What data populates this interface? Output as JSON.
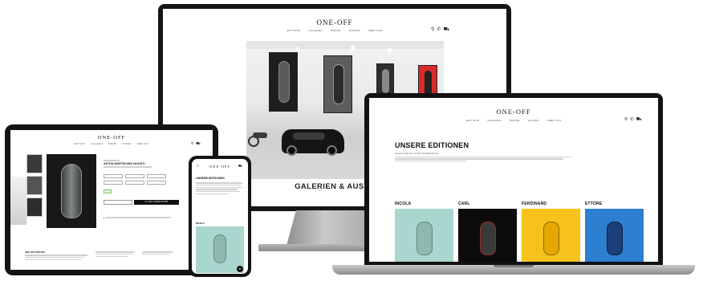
{
  "brand": {
    "logo": "ONE-OFF",
    "nav": [
      "EDITIONS",
      "GALERIEN",
      "PREISE",
      "WISSEN",
      "ÜBER UNS"
    ],
    "icons": [
      "search-icon",
      "phone-icon",
      "cart-icon"
    ]
  },
  "monitor": {
    "caption": "GALERIEN & AUSSTELLU"
  },
  "laptop": {
    "heading": "UNSERE EDITIONEN",
    "intro": "Entdeckt ONE-OFF und ihre Wandbildeditionen",
    "editions": [
      {
        "name": "NICOLA",
        "bg": "#a9d6cf",
        "car": "#8fb8ae"
      },
      {
        "name": "CARL",
        "bg": "#0b0b0b",
        "car": "#3a3a3a"
      },
      {
        "name": "FERDINAND",
        "bg": "#f6c21b",
        "car": "#e6a800"
      },
      {
        "name": "ETTORE",
        "bg": "#2d7fd0",
        "car": "#1c3f7a"
      }
    ]
  },
  "tablet": {
    "product_title": "ASTON MARTIN DB4 ZAGATO",
    "order_button": "IN DEN WARENKORB",
    "section_title": "ONE-OFF EDITION"
  },
  "phone": {
    "heading": "UNSERE EDITIONEN",
    "card_title": "NICOLA"
  },
  "colors": {
    "accent_mint": "#a9d6cf",
    "accent_yellow": "#f6c21b",
    "accent_blue": "#2d7fd0",
    "accent_red": "#d92b2b"
  }
}
